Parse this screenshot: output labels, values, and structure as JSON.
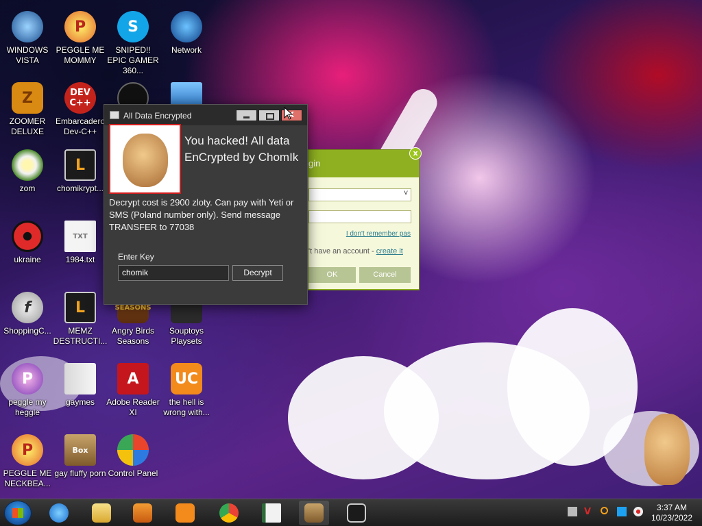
{
  "desktop": {
    "icons": [
      {
        "label": "WINDOWS VISTA",
        "icon": "vista-icon"
      },
      {
        "label": "PEGGLE ME MOMMY",
        "icon": "peggle-icon"
      },
      {
        "label": "SNIPED!! EPIC GAMER 360...",
        "icon": "skype-icon"
      },
      {
        "label": "Network",
        "icon": "network-icon"
      },
      {
        "label": "ZOOMER DELUXE",
        "icon": "zuma-icon"
      },
      {
        "label": "Embarcadero Dev-C++",
        "icon": "devcpp-icon"
      },
      {
        "label": "zom",
        "icon": "flower-icon"
      },
      {
        "label": "chomikrypt...",
        "icon": "lnk-icon"
      },
      {
        "label": "ukraine",
        "icon": "radiation-icon"
      },
      {
        "label": "1984.txt",
        "icon": "text-file-icon"
      },
      {
        "label": "ShoppingC...",
        "icon": "flash-icon"
      },
      {
        "label": "MEMZ DESTRUCTI...",
        "icon": "lnk-icon"
      },
      {
        "label": "Angry Birds Seasons",
        "icon": "angry-birds-icon"
      },
      {
        "label": "Souptoys Playsets",
        "icon": "souptoys-icon"
      },
      {
        "label": "peggle my heggle",
        "icon": "peggle-icon"
      },
      {
        "label": "gaymes",
        "icon": "folder-icon"
      },
      {
        "label": "Adobe Reader XI",
        "icon": "adobe-reader-icon"
      },
      {
        "label": "the hell is wrong with...",
        "icon": "uc-browser-icon"
      },
      {
        "label": "PEGGLE ME NECKBEA...",
        "icon": "peggle-icon"
      },
      {
        "label": "gay fluffy porn",
        "icon": "hamster-box-icon"
      },
      {
        "label": "Control Panel",
        "icon": "control-panel-icon"
      }
    ]
  },
  "ransom_window": {
    "title": "All Data Encrypted",
    "headline": "You hacked! All data EnCrypted by ChomIk",
    "message": "Decrypt cost is 2900 zloty. Can pay with Yeti or SMS (Poland number only). Send message TRANSFER to 77038",
    "key_label": "Enter Key",
    "key_value": "chomik",
    "decrypt_button": "Decrypt",
    "close_glyph": "x"
  },
  "login_window": {
    "title": "gin",
    "forgot": "I don't remember pas",
    "account_text": "'t have an account - ",
    "create_link": "create it",
    "ok_button": "OK",
    "cancel_button": "Cancel",
    "close_glyph": "x",
    "select_arrow": "v"
  },
  "taskbar": {
    "pinned": [
      "internet-explorer-icon",
      "file-explorer-icon",
      "media-player-icon",
      "uc-browser-icon",
      "chrome-icon",
      "notepad-icon",
      "hamster-box-icon",
      "lnk-icon"
    ],
    "tray": [
      "taskbar-icon",
      "av-icon",
      "search-icon",
      "network-icon",
      "webcam-icon"
    ],
    "time": "3:37 AM",
    "date": "10/23/2022"
  },
  "colors": {
    "window_bg": "#3b3b3b",
    "titlebar_bg": "#2b2b2b",
    "close_button": "#e0706a",
    "login_accent": "#8fb021",
    "hamster_border": "#d41d1d"
  }
}
